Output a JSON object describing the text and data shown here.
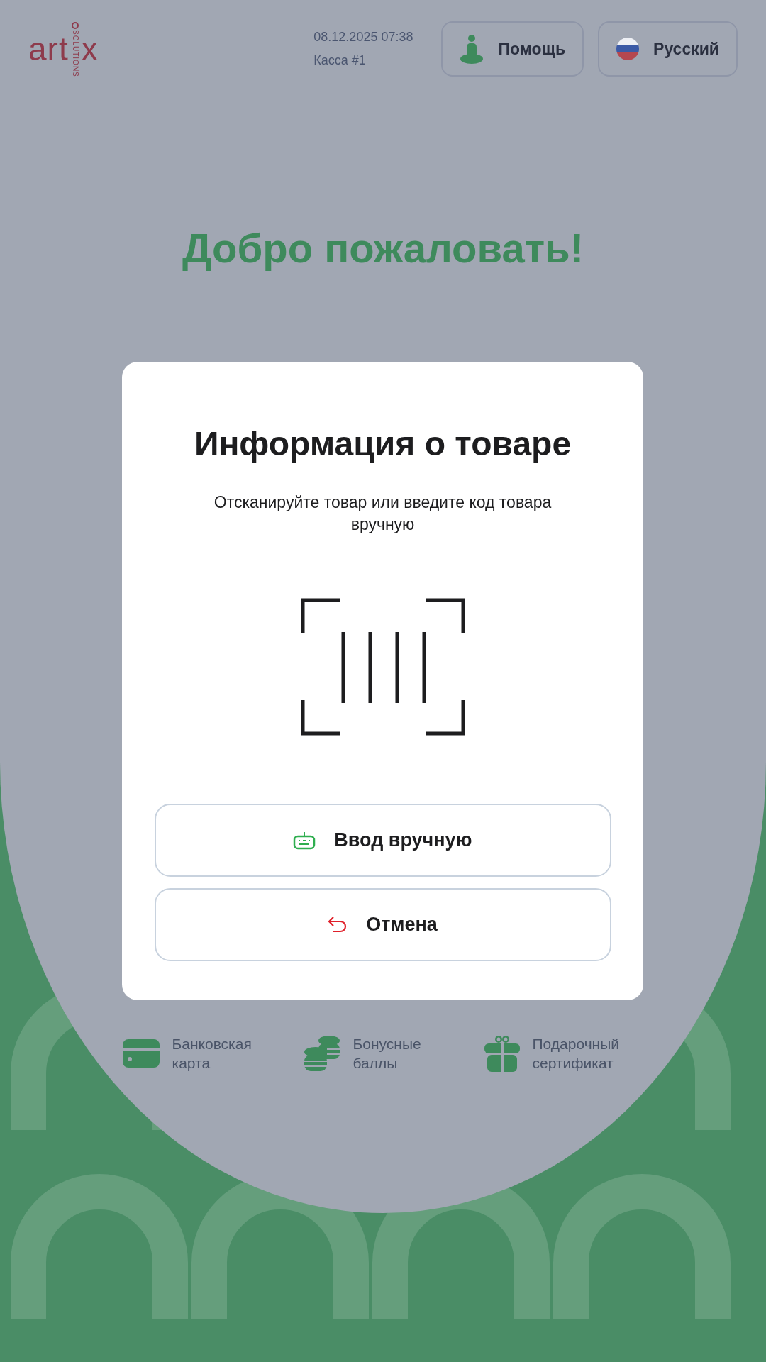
{
  "header": {
    "logo": {
      "text_left": "art",
      "text_right": "x",
      "tagline": "SOLUTIONS"
    },
    "datetime": "08.12.2025 07:38",
    "register": "Касса #1",
    "buttons": [
      {
        "kind": "help",
        "label": "Помощь"
      },
      {
        "kind": "language",
        "label": "Русский"
      }
    ]
  },
  "welcome": "Добро пожаловать!",
  "payment_methods": [
    {
      "kind": "card",
      "label": "Банковская карта"
    },
    {
      "kind": "bonus",
      "label": "Бонусные баллы"
    },
    {
      "kind": "gift",
      "label": "Подарочный сертификат"
    }
  ],
  "dialog": {
    "title": "Информация о товаре",
    "message": "Отсканируйте товар или введите код товара вручную",
    "buttons": [
      {
        "kind": "manual",
        "label": "Ввод вручную"
      },
      {
        "kind": "cancel",
        "label": "Отмена"
      }
    ]
  }
}
